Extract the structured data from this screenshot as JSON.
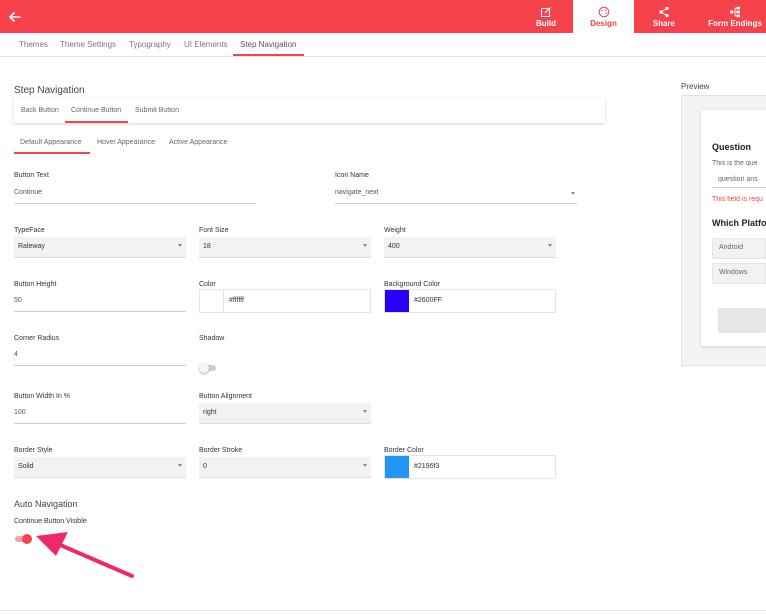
{
  "topbar": {
    "items": [
      {
        "label": "Build",
        "icon": "edit-icon"
      },
      {
        "label": "Design",
        "icon": "palette-icon"
      },
      {
        "label": "Share",
        "icon": "share-icon"
      },
      {
        "label": "Form Endings",
        "icon": "sitemap-icon"
      }
    ],
    "active": "Design"
  },
  "subnav": {
    "items": [
      "Themes",
      "Theme Settings",
      "Typography",
      "UI Elements",
      "Step Navigation"
    ],
    "active": "Step Navigation"
  },
  "section": {
    "title": "Step Navigation",
    "button_tabs": [
      "Back Button",
      "Continue Button",
      "Submit Button"
    ],
    "active_button_tab": "Continue Button",
    "appearance_tabs": [
      "Default Appearance",
      "Hover Appearance",
      "Active Appearance"
    ],
    "active_appearance_tab": "Default Appearance"
  },
  "form": {
    "button_text": {
      "label": "Button Text",
      "value": "Continue"
    },
    "icon_name": {
      "label": "Icon Name",
      "value": "navigate_next"
    },
    "typeface": {
      "label": "TypeFace",
      "value": "Raleway"
    },
    "font_size": {
      "label": "Font Size",
      "value": "18"
    },
    "weight": {
      "label": "Weight",
      "value": "400"
    },
    "button_height": {
      "label": "Button Height",
      "value": "50"
    },
    "color": {
      "label": "Color",
      "value": "#ffffff"
    },
    "background_color": {
      "label": "Background Color",
      "value": "#2600FF"
    },
    "corner_radius": {
      "label": "Corner Radius",
      "value": "4"
    },
    "shadow": {
      "label": "Shadow",
      "on": false
    },
    "button_width": {
      "label": "Button Width In %",
      "value": "100"
    },
    "button_alignment": {
      "label": "Button Alignment",
      "value": "right"
    },
    "border_style": {
      "label": "Border Style",
      "value": "Solid"
    },
    "border_stroke": {
      "label": "Border Stroke",
      "value": "0"
    },
    "border_color": {
      "label": "Border Color",
      "value": "#2196f3"
    }
  },
  "auto_navigation": {
    "title": "Auto Navigation",
    "continue_visible": {
      "label": "Continue Button Visible",
      "on": true
    }
  },
  "preview": {
    "label": "Preview",
    "question_title": "Question",
    "question_desc": "This is the que",
    "answer_placeholder": "question ans",
    "error_text": "This field is requ",
    "second_question": "Which Platfo",
    "options": [
      "Android",
      "Windows"
    ]
  },
  "colors": {
    "accent": "#f5424b",
    "annotation_arrow": "#f0286a",
    "toggle_on": "#f5424b",
    "toggle_off": "#cccccc"
  }
}
